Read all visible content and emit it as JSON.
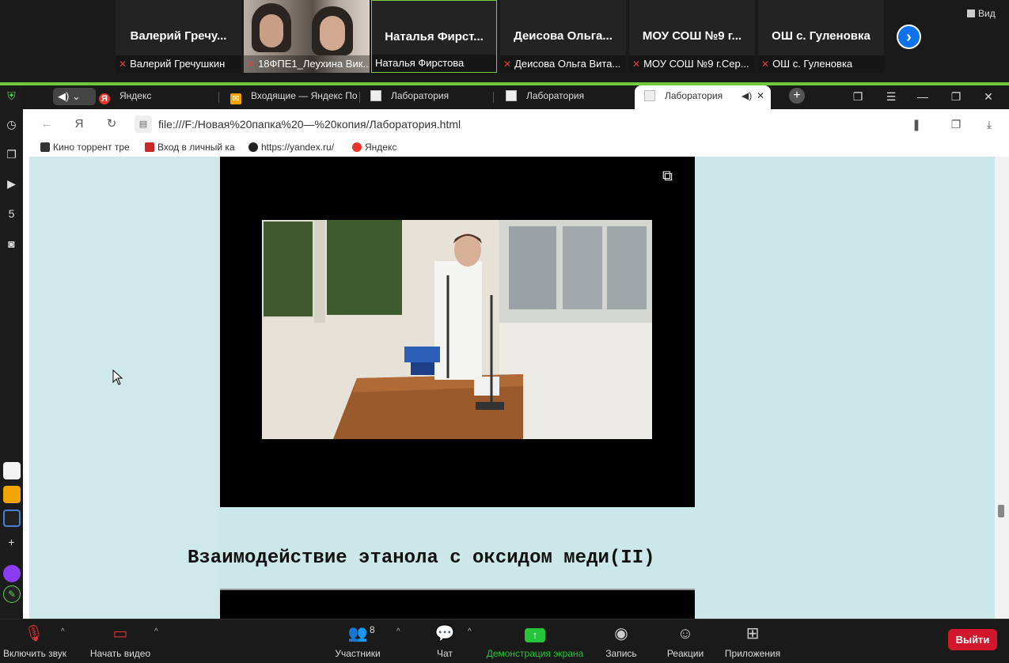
{
  "zoom": {
    "participants": [
      {
        "display_name": "Валерий Гречу...",
        "label": "Валерий Гречушкин",
        "muted": true,
        "video": false
      },
      {
        "display_name": "",
        "label": "18ФПЕ1_Леухина Вик...",
        "muted": true,
        "video": true
      },
      {
        "display_name": "Наталья Фирст...",
        "label": "Наталья Фирстова",
        "muted": false,
        "video": false,
        "active": true
      },
      {
        "display_name": "Деисова Ольга...",
        "label": "Деисова Ольга Вита...",
        "muted": true,
        "video": false
      },
      {
        "display_name": "МОУ СОШ №9 г...",
        "label": "МОУ СОШ №9 г.Сер...",
        "muted": true,
        "video": false
      },
      {
        "display_name": "ОШ с. Гуленовка",
        "label": "ОШ с. Гуленовка",
        "muted": true,
        "video": false
      }
    ],
    "view_label": "Вид",
    "controls": {
      "unmute": "Включить звук",
      "start_video": "Начать видео",
      "participants": "Участники",
      "participants_count": "8",
      "chat": "Чат",
      "share": "Демонстрация экрана",
      "record": "Запись",
      "reactions": "Реакции",
      "apps": "Приложения",
      "leave": "Выйти"
    },
    "share_border_color": "#6ec93c",
    "leave_color": "#d1172b"
  },
  "browser": {
    "tabs": [
      {
        "label": "Яндекс",
        "icon": "yandex-icon"
      },
      {
        "label": "Входящие — Яндекс По",
        "icon": "mail-icon"
      },
      {
        "label": "Лаборатория",
        "icon": "page-icon"
      },
      {
        "label": "Лаборатория",
        "icon": "page-icon"
      },
      {
        "label": "Лаборатория",
        "icon": "page-icon",
        "active": true
      }
    ],
    "url": "file:///F:/Новая%20папка%20—%20копия/Лаборатория.html",
    "bookmarks": [
      {
        "label": "Кино торрент тре"
      },
      {
        "label": "Вход в личный ка"
      },
      {
        "label": "https://yandex.ru/"
      },
      {
        "label": "Яндекс"
      }
    ]
  },
  "page": {
    "section_heading": "Взаимодействие этанола с оксидом меди(II)",
    "background_color": "#cce7e8"
  }
}
